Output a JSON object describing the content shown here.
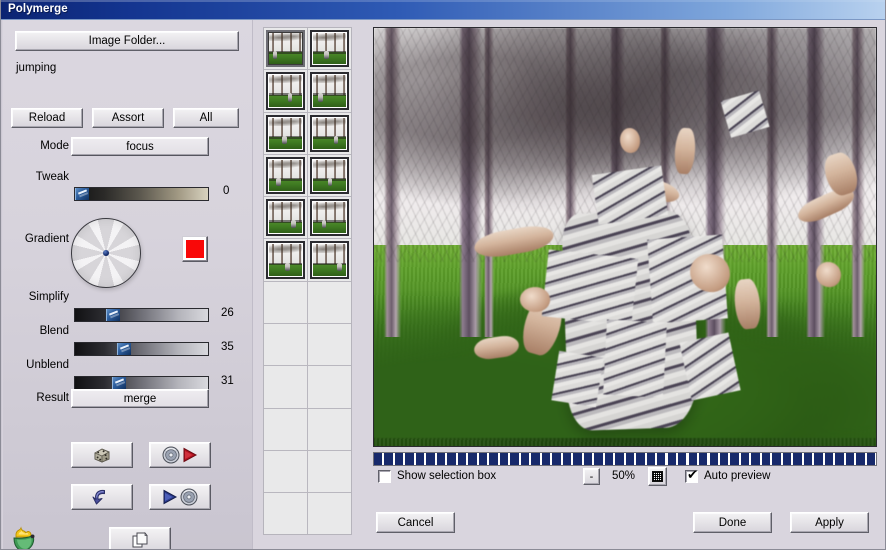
{
  "window": {
    "title": "Polymerge",
    "titlebar_gradient_start": "#0b2472",
    "titlebar_gradient_end": "#b9d2ef",
    "panel_bg": "#d9d5de"
  },
  "left_panel": {
    "image_folder_button": "Image Folder...",
    "folder_name": "jumping",
    "reload_button": "Reload",
    "assort_button": "Assort",
    "all_button": "All",
    "mode": {
      "label": "Mode",
      "value": "focus"
    },
    "tweak": {
      "label": "Tweak",
      "value": "0",
      "percent": 0
    },
    "gradient": {
      "label": "Gradient",
      "color": "#f90808"
    },
    "simplify": {
      "label": "Simplify",
      "value": "26",
      "percent": 26
    },
    "blend": {
      "label": "Blend",
      "value": "35",
      "percent": 35
    },
    "unblend": {
      "label": "Unblend",
      "value": "31",
      "percent": 31
    },
    "result": {
      "label": "Result",
      "value": "merge"
    },
    "action_icons": [
      {
        "name": "randomize",
        "icon": "dice-icon"
      },
      {
        "name": "load-settings",
        "icon": "disc-load-icon"
      },
      {
        "name": "undo",
        "icon": "undo-arrow-icon"
      },
      {
        "name": "save-settings",
        "icon": "disc-save-icon"
      },
      {
        "name": "copy",
        "icon": "copy-pages-icon"
      }
    ],
    "logo_icon": "flame-logo-icon"
  },
  "thumbnails": {
    "columns": 2,
    "total_cells": 24,
    "filled_count": 12,
    "items": [
      {
        "index": 1,
        "selected": false
      },
      {
        "index": 2,
        "selected": true
      },
      {
        "index": 3,
        "selected": true
      },
      {
        "index": 4,
        "selected": true
      },
      {
        "index": 5,
        "selected": true
      },
      {
        "index": 6,
        "selected": true
      },
      {
        "index": 7,
        "selected": true
      },
      {
        "index": 8,
        "selected": true
      },
      {
        "index": 9,
        "selected": true
      },
      {
        "index": 10,
        "selected": true
      },
      {
        "index": 11,
        "selected": true
      },
      {
        "index": 12,
        "selected": true
      }
    ]
  },
  "preview": {
    "description": "merged forest jumping composite",
    "progress_percent": 100,
    "progress_color": "#17296b",
    "show_selection_box": {
      "label": "Show selection box",
      "checked": false
    },
    "zoom_out_button": "-",
    "zoom_level": "50%",
    "zoom_fit_icon": "fit-grid-icon",
    "auto_preview": {
      "label": "Auto preview",
      "checked": true,
      "checkmark": "✔"
    }
  },
  "footer": {
    "cancel_button": "Cancel",
    "done_button": "Done",
    "apply_button": "Apply"
  }
}
